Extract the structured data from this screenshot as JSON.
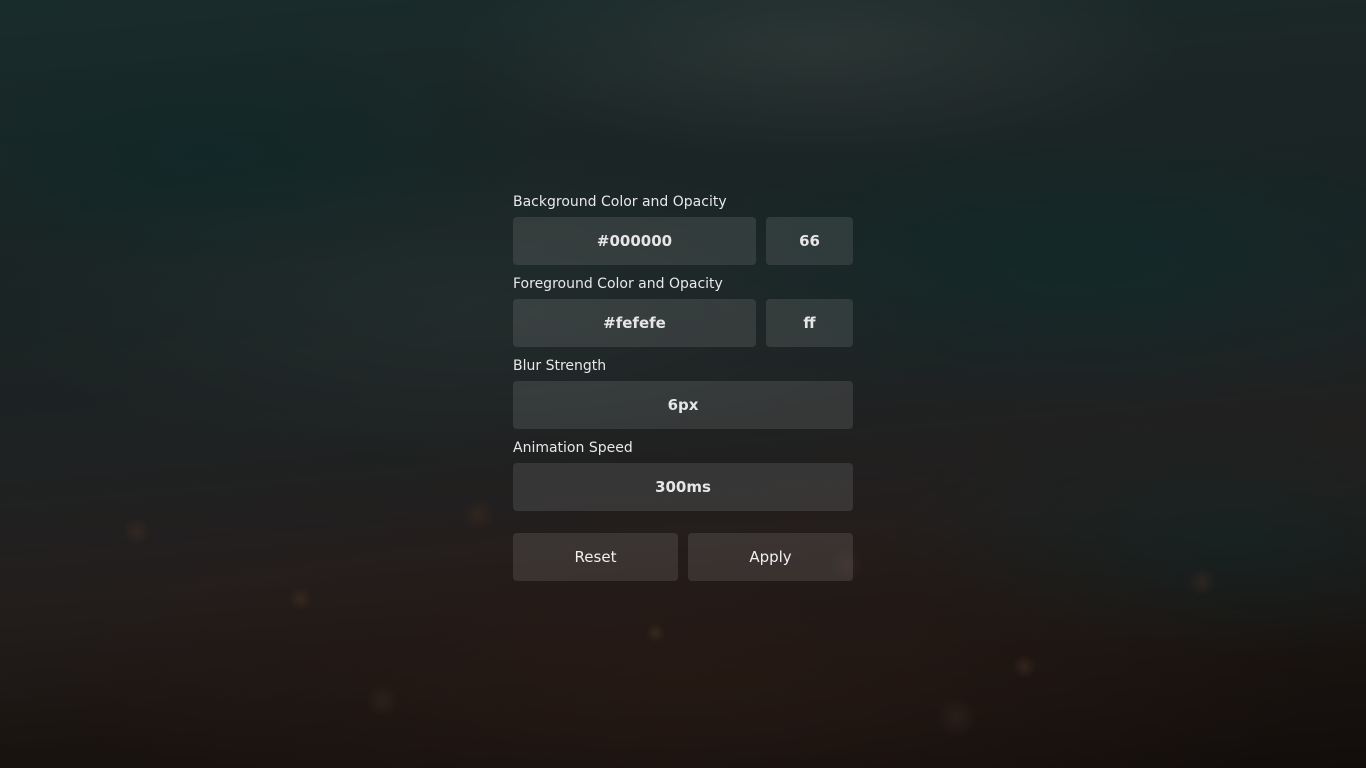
{
  "settings": {
    "background": {
      "label": "Background Color and Opacity",
      "color_value": "#000000",
      "opacity_value": "66"
    },
    "foreground": {
      "label": "Foreground Color and Opacity",
      "color_value": "#fefefe",
      "opacity_value": "ff"
    },
    "blur": {
      "label": "Blur Strength",
      "value": "6px"
    },
    "animation": {
      "label": "Animation Speed",
      "value": "300ms"
    }
  },
  "actions": {
    "reset_label": "Reset",
    "apply_label": "Apply"
  },
  "colors": {
    "overlay": "#000000",
    "text": "#fefefe"
  }
}
